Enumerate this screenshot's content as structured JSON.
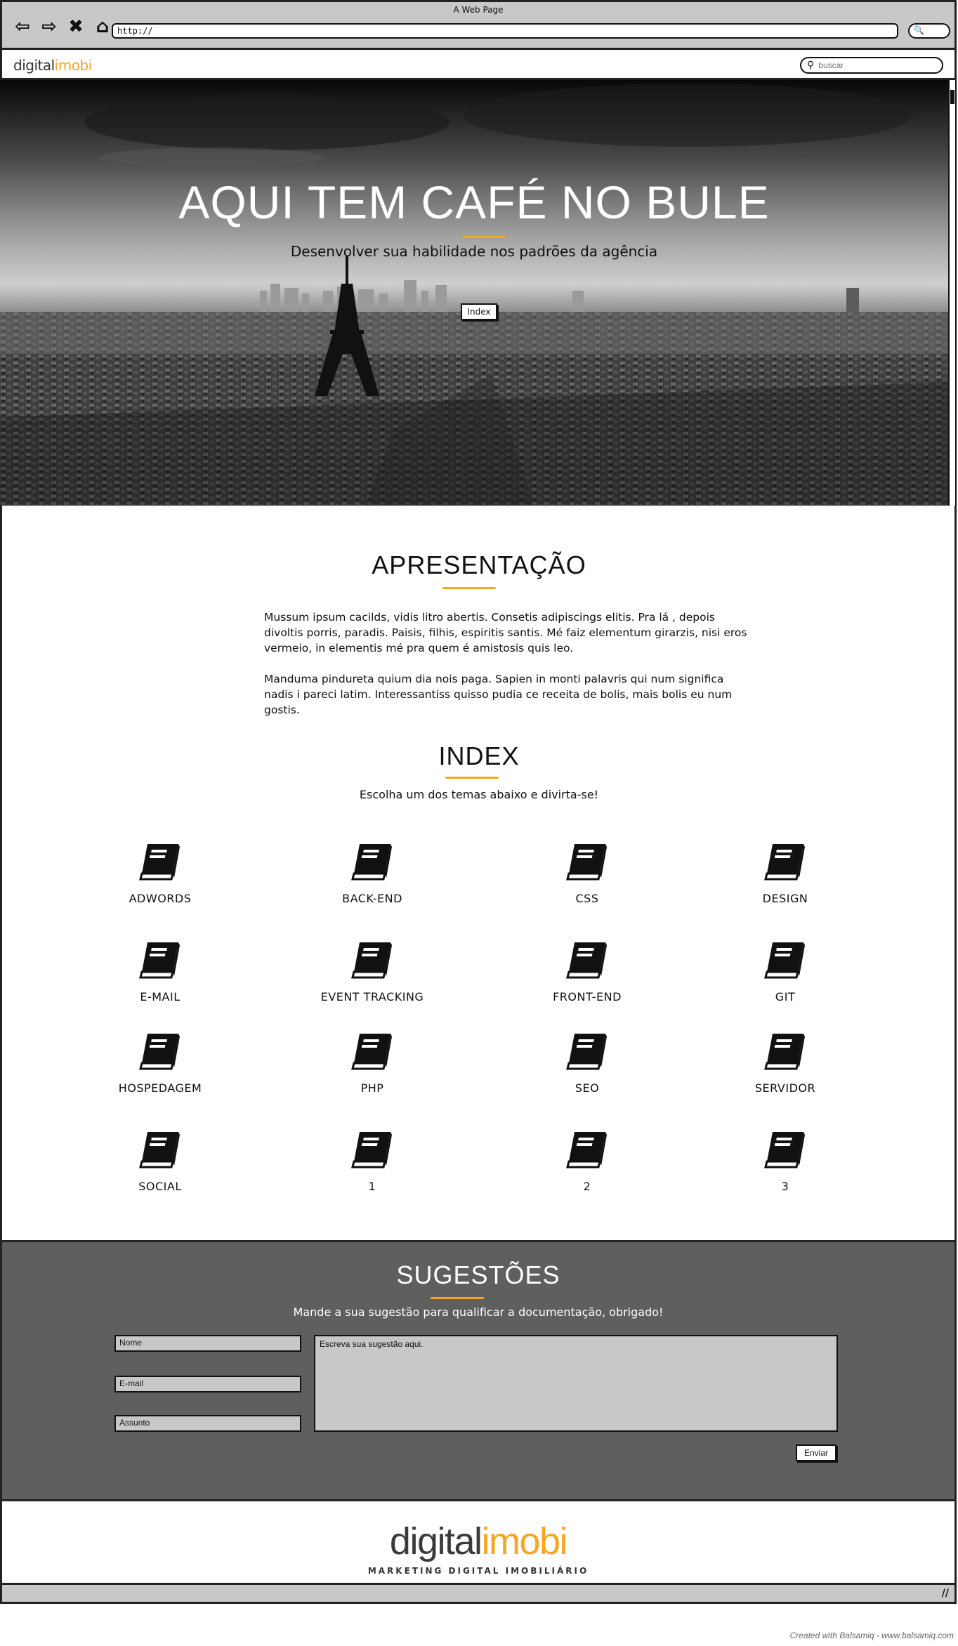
{
  "browser": {
    "window_title": "A Web Page",
    "url": "http://",
    "nav_icons": [
      "back-icon",
      "forward-icon",
      "close-icon",
      "home-icon"
    ],
    "search_glyph": "🔍"
  },
  "header": {
    "logo_part1": "digital",
    "logo_part2": "imobi",
    "search_placeholder": "buscar"
  },
  "hero": {
    "title": "AQUI TEM CAFÉ NO BULE",
    "subtitle": "Desenvolver sua habilidade nos padrões da agência",
    "button_label": "Index"
  },
  "presentation": {
    "title": "APRESENTAÇÃO",
    "paragraph1": "Mussum ipsum cacilds, vidis litro abertis. Consetis adipiscings elitis. Pra lá , depois divoltis porris, paradis. Paisis, filhis, espiritis santis. Mé faiz elementum girarzis, nisi eros vermeio, in elementis mé pra quem é amistosis quis leo.",
    "paragraph2": "Manduma pindureta quium dia nois paga. Sapien in monti palavris qui num significa nadis i pareci latim. Interessantiss quisso pudia ce receita de bolis, mais bolis eu num gostis."
  },
  "index": {
    "title": "INDEX",
    "subtitle": "Escolha um dos temas abaixo e divirta-se!",
    "items": [
      {
        "label": "ADWORDS"
      },
      {
        "label": "BACK-END"
      },
      {
        "label": "CSS"
      },
      {
        "label": "DESIGN"
      },
      {
        "label": "E-MAIL"
      },
      {
        "label": "EVENT TRACKING"
      },
      {
        "label": "FRONT-END"
      },
      {
        "label": "GIT"
      },
      {
        "label": "HOSPEDAGEM"
      },
      {
        "label": "PHP"
      },
      {
        "label": "SEO"
      },
      {
        "label": "SERVIDOR"
      },
      {
        "label": "SOCIAL"
      },
      {
        "label": "1"
      },
      {
        "label": "2"
      },
      {
        "label": "3"
      }
    ]
  },
  "suggestions": {
    "title": "SUGESTÕES",
    "subtitle": "Mande a sua sugestão para qualificar a documentação, obrigado!",
    "name_placeholder": "Nome",
    "email_placeholder": "E-mail",
    "subject_placeholder": "Assunto",
    "message_placeholder": "Escreva sua sugestão aqui.",
    "send_label": "Enviar"
  },
  "footer": {
    "logo_part1": "digital",
    "logo_part2": "imobi",
    "tagline": "MARKETING DIGITAL IMOBILIÁRIO"
  },
  "credit": "Created with Balsamiq - www.balsamiq.com",
  "colors": {
    "accent": "#f5a623",
    "suggestions_bg": "#5f5f5f",
    "chrome_bg": "#c8c8c8"
  }
}
